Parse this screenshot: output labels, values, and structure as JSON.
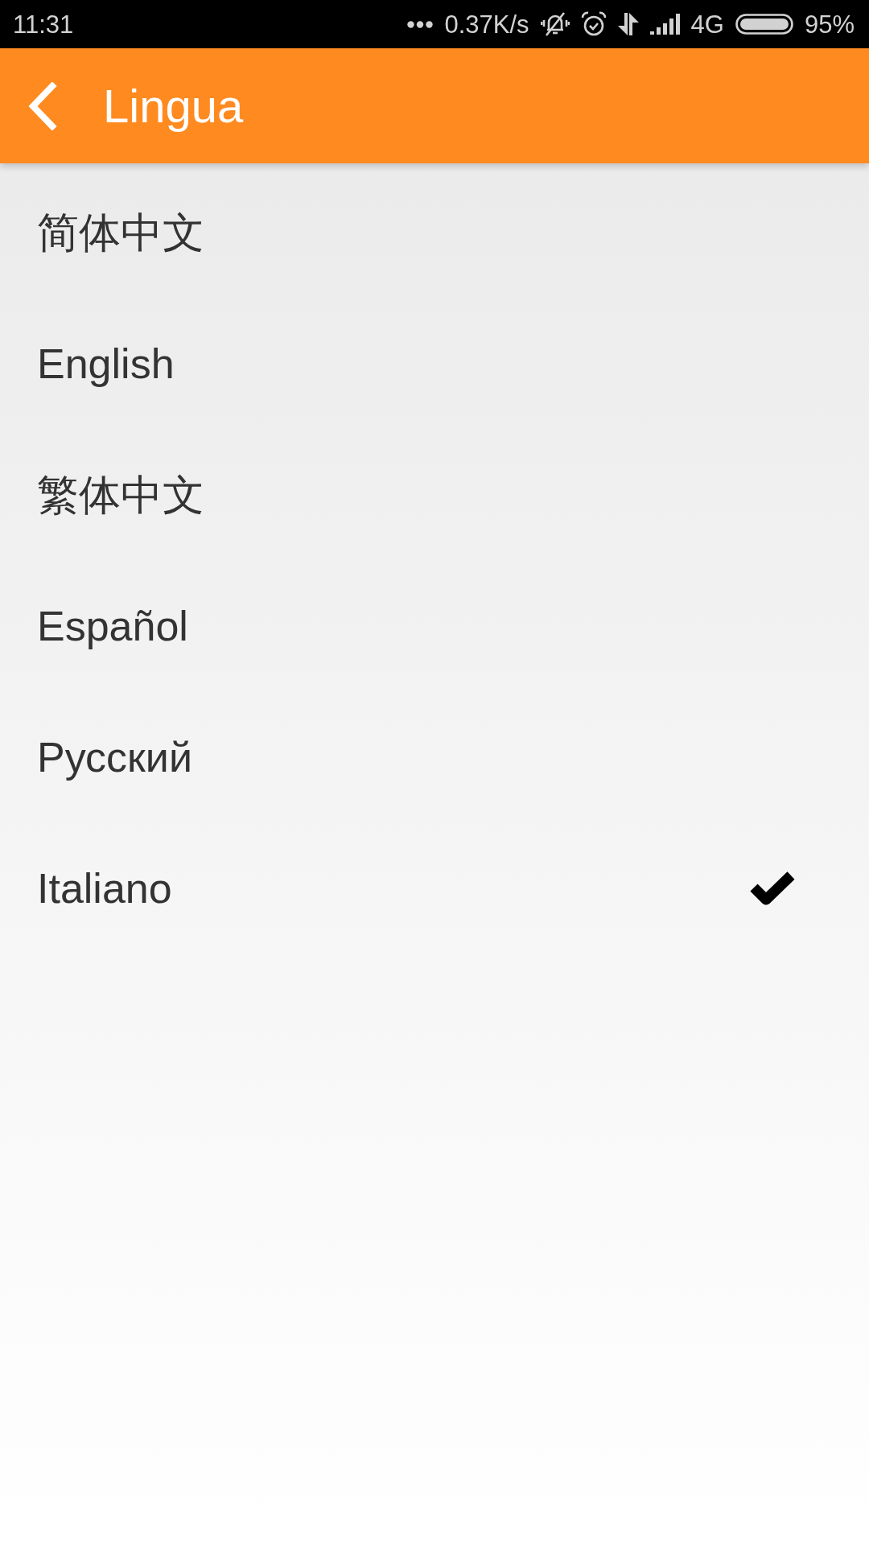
{
  "status_bar": {
    "time": "11:31",
    "network_speed": "0.37K/s",
    "network_type": "4G",
    "battery": "95%"
  },
  "app_bar": {
    "title": "Lingua"
  },
  "languages": [
    {
      "label": "简体中文",
      "selected": false
    },
    {
      "label": "English",
      "selected": false
    },
    {
      "label": "繁体中文",
      "selected": false
    },
    {
      "label": "Español",
      "selected": false
    },
    {
      "label": "Русский",
      "selected": false
    },
    {
      "label": "Italiano",
      "selected": true
    }
  ]
}
